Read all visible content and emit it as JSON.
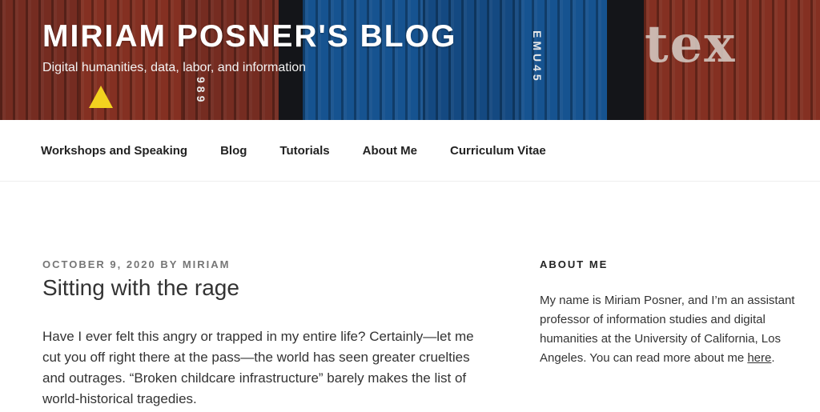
{
  "site": {
    "title": "MIRIAM POSNER'S BLOG",
    "description": "Digital humanities, data, labor, and information",
    "header_image_text": "tex"
  },
  "nav": {
    "items": [
      "Workshops and Speaking",
      "Blog",
      "Tutorials",
      "About Me",
      "Curriculum Vitae"
    ]
  },
  "post": {
    "date": "OCTOBER 9, 2020",
    "by": "BY",
    "author": "MIRIAM",
    "title": "Sitting with the rage",
    "excerpt": "Have I ever felt this angry or trapped in my entire life? Certainly—let me cut you off right there at the pass—the world has seen greater cruelties and outrages. “Broken childcare infrastructure” barely makes the list of world-historical tragedies."
  },
  "sidebar": {
    "widget_title": "ABOUT ME",
    "text_before_link": "My name is Miriam Posner, and I’m an assistant professor of information studies and digital humanities at the University of California, Los Angeles. You can read more about me ",
    "link_text": "here",
    "text_after_link": "."
  },
  "colors": {
    "header_red": "#9c3b2c",
    "header_blue": "#1e6fc0"
  }
}
